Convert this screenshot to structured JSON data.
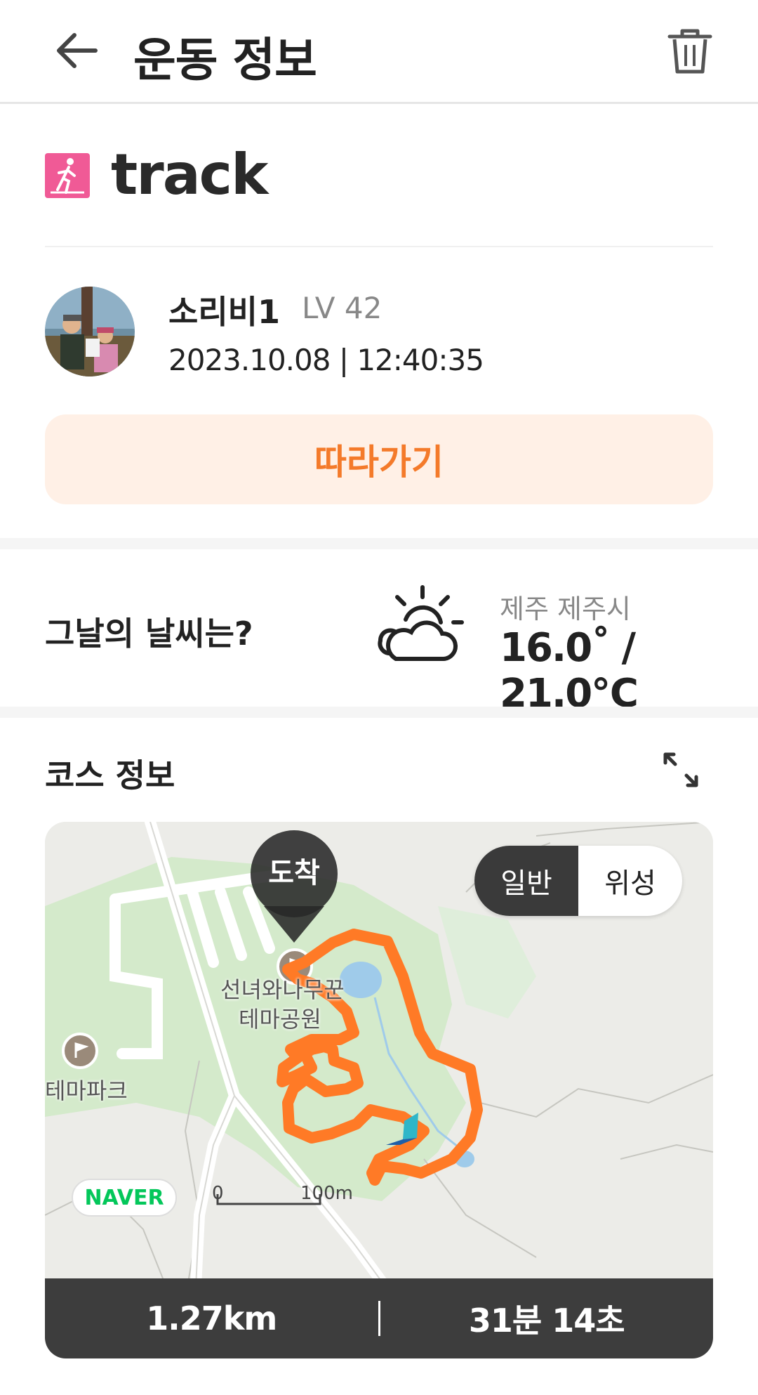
{
  "header": {
    "title": "운동 정보",
    "back_icon": "arrow-left-icon",
    "delete_icon": "trash-icon"
  },
  "activity": {
    "icon": "walking-icon",
    "icon_color": "#f05a96",
    "title": "track"
  },
  "user": {
    "name": "소리비1",
    "level": "LV 42",
    "timestamp": "2023.10.08 | 12:40:35"
  },
  "follow_button": {
    "label": "따라가기",
    "text_color": "#f47a2a",
    "bg_color": "#fff0e6"
  },
  "weather": {
    "question": "그날의 날씨는?",
    "icon": "partly-cloudy-icon",
    "location": "제주 제주시",
    "temperature": "16.0˚ / 21.0℃"
  },
  "course": {
    "title": "코스 정보",
    "expand_icon": "expand-icon",
    "map": {
      "toggle": [
        "일반",
        "위성"
      ],
      "active_toggle": "일반",
      "marker_label": "도착",
      "places": [
        "선녀와나무꾼",
        "테마공원",
        "테마파크"
      ],
      "provider": "NAVER",
      "scale_start": "0",
      "scale_end": "100m",
      "route_color": "#ff7a26"
    },
    "stats": {
      "distance": "1.27km",
      "duration": "31분 14초"
    }
  }
}
